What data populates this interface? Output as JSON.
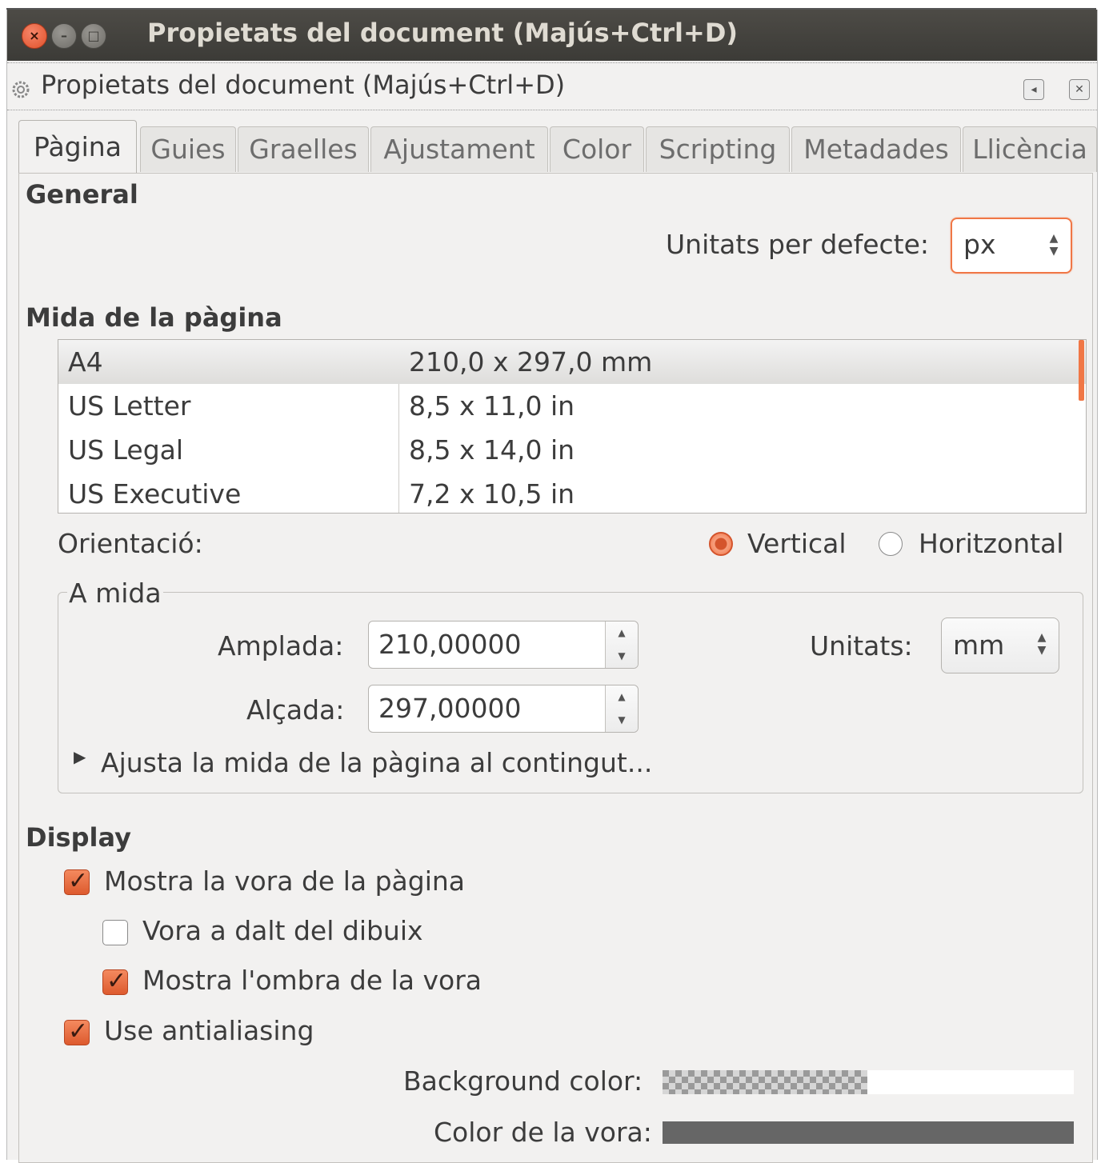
{
  "window": {
    "title": "Propietats del document (Majús+Ctrl+D)",
    "buttons": [
      "×",
      "–",
      "□"
    ]
  },
  "dock": {
    "title": "Propietats del document (Majús+Ctrl+D)",
    "btn_restore": "◂",
    "btn_close": "✕"
  },
  "tabs": [
    "Pàgina",
    "Guies",
    "Graelles",
    "Ajustament",
    "Color",
    "Scripting",
    "Metadades",
    "Llicència"
  ],
  "general": {
    "header": "General",
    "units_label": "Unitats per defecte:",
    "units_value": "px"
  },
  "page_size": {
    "header": "Mida de la pàgina",
    "rows": [
      {
        "name": "A4",
        "size": "210,0 x 297,0 mm"
      },
      {
        "name": "US Letter",
        "size": "8,5 x 11,0 in"
      },
      {
        "name": "US Legal",
        "size": "8,5 x 14,0 in"
      },
      {
        "name": "US Executive",
        "size": "7,2 x 10,5 in"
      }
    ]
  },
  "orientation": {
    "label": "Orientació:",
    "vertical": "Vertical",
    "horizontal": "Horitzontal",
    "selected": "Vertical"
  },
  "custom": {
    "legend": "A mida",
    "width_label": "Amplada:",
    "width_value": "210,00000",
    "height_label": "Alçada:",
    "height_value": "297,00000",
    "units_label": "Unitats:",
    "units_value": "mm",
    "expander_label": "Ajusta la mida de la pàgina al contingut..."
  },
  "display": {
    "header": "Display",
    "show_border": "Mostra la vora de la pàgina",
    "border_on_top": "Vora a dalt del dibuix",
    "show_shadow": "Mostra l'ombra de la vora",
    "antialiasing": "Use antialiasing",
    "bg_color_label": "Background color:",
    "border_color_label": "Color de la vora:",
    "border_color": "#666666"
  },
  "colors": {
    "accent": "#f07746",
    "titlebar": "#3c3b37",
    "window_bg": "#f2f1f0"
  }
}
